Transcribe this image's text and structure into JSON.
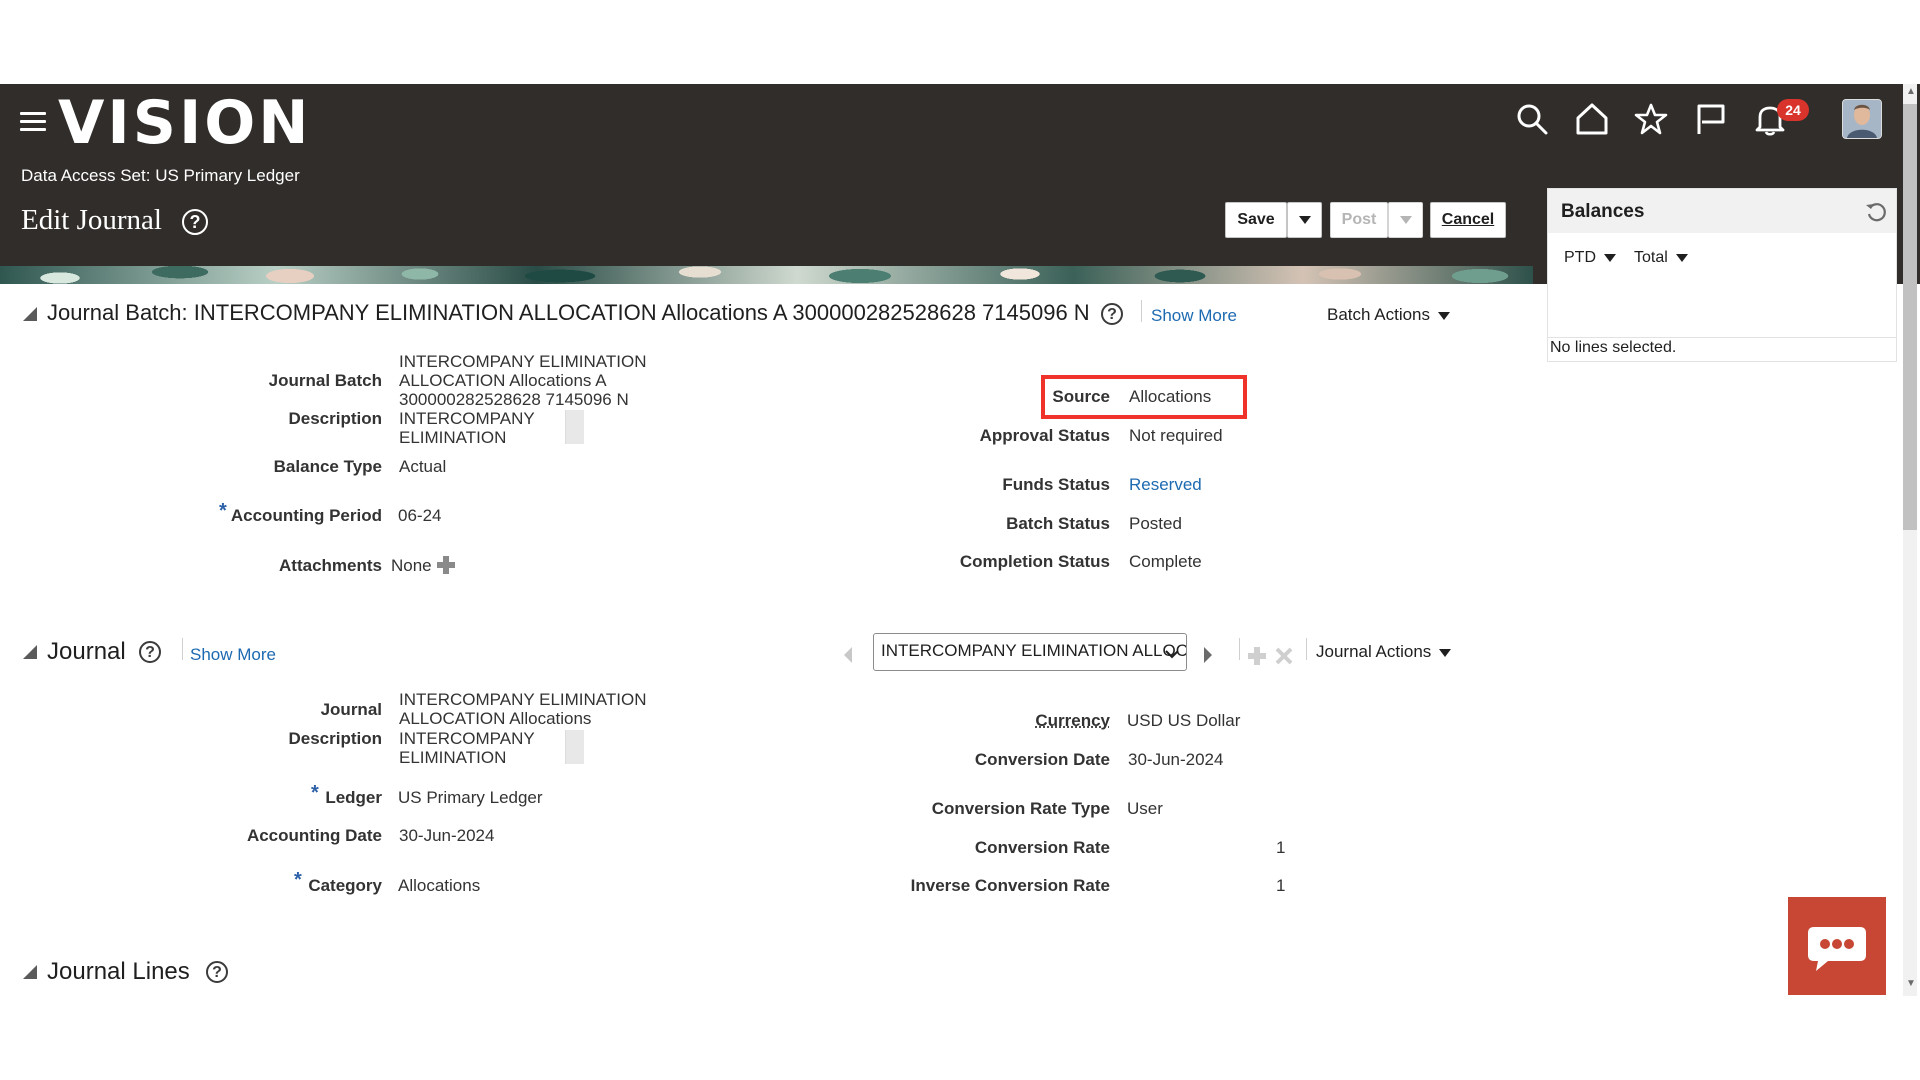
{
  "header": {
    "logo": "VISION",
    "data_access_set_label": "Data Access Set:",
    "data_access_set_value": "US Primary Ledger",
    "page_title": "Edit Journal",
    "notification_count": "24",
    "icons": [
      "search-icon",
      "home-icon",
      "star-icon",
      "flag-icon",
      "bell-icon"
    ]
  },
  "toolbar": {
    "save_label": "Save",
    "post_label": "Post",
    "cancel_label": "Cancel"
  },
  "balances": {
    "title": "Balances",
    "ptd": "PTD",
    "total": "Total",
    "no_lines": "No lines selected."
  },
  "batch": {
    "title": "Journal Batch: INTERCOMPANY ELIMINATION ALLOCATION Allocations A 300000282528628 7145096 N",
    "show_more": "Show More",
    "actions": "Batch Actions",
    "fields": {
      "journal_batch_label": "Journal Batch",
      "journal_batch_value": "INTERCOMPANY ELIMINATION ALLOCATION Allocations A 300000282528628 7145096 N",
      "description_label": "Description",
      "description_value": "INTERCOMPANY ELIMINATION",
      "balance_type_label": "Balance Type",
      "balance_type_value": "Actual",
      "accounting_period_label": "Accounting Period",
      "accounting_period_value": "06-24",
      "attachments_label": "Attachments",
      "attachments_value": "None",
      "source_label": "Source",
      "source_value": "Allocations",
      "approval_status_label": "Approval Status",
      "approval_status_value": "Not required",
      "funds_status_label": "Funds Status",
      "funds_status_value": "Reserved",
      "batch_status_label": "Batch Status",
      "batch_status_value": "Posted",
      "completion_status_label": "Completion Status",
      "completion_status_value": "Complete"
    }
  },
  "journal": {
    "title": "Journal",
    "show_more": "Show More",
    "selector_value": "INTERCOMPANY ELIMINATION ALLOCATION Allocations",
    "actions": "Journal Actions",
    "fields": {
      "journal_label": "Journal",
      "journal_value": "INTERCOMPANY ELIMINATION ALLOCATION Allocations",
      "description_label": "Description",
      "description_value": "INTERCOMPANY ELIMINATION",
      "ledger_label": "Ledger",
      "ledger_value": "US Primary Ledger",
      "accounting_date_label": "Accounting Date",
      "accounting_date_value": "30-Jun-2024",
      "category_label": "Category",
      "category_value": "Allocations",
      "currency_label": "Currency",
      "currency_value": "USD US Dollar",
      "conversion_date_label": "Conversion Date",
      "conversion_date_value": "30-Jun-2024",
      "conversion_rate_type_label": "Conversion Rate Type",
      "conversion_rate_type_value": "User",
      "conversion_rate_label": "Conversion Rate",
      "conversion_rate_value": "1",
      "inverse_conversion_rate_label": "Inverse Conversion Rate",
      "inverse_conversion_rate_value": "1"
    }
  },
  "journal_lines": {
    "title": "Journal Lines"
  },
  "colors": {
    "header_bg": "#312d2a",
    "link": "#1d6ab1",
    "highlight": "#f0332a",
    "chat_fab": "#c74634",
    "badge": "#d9342b"
  }
}
